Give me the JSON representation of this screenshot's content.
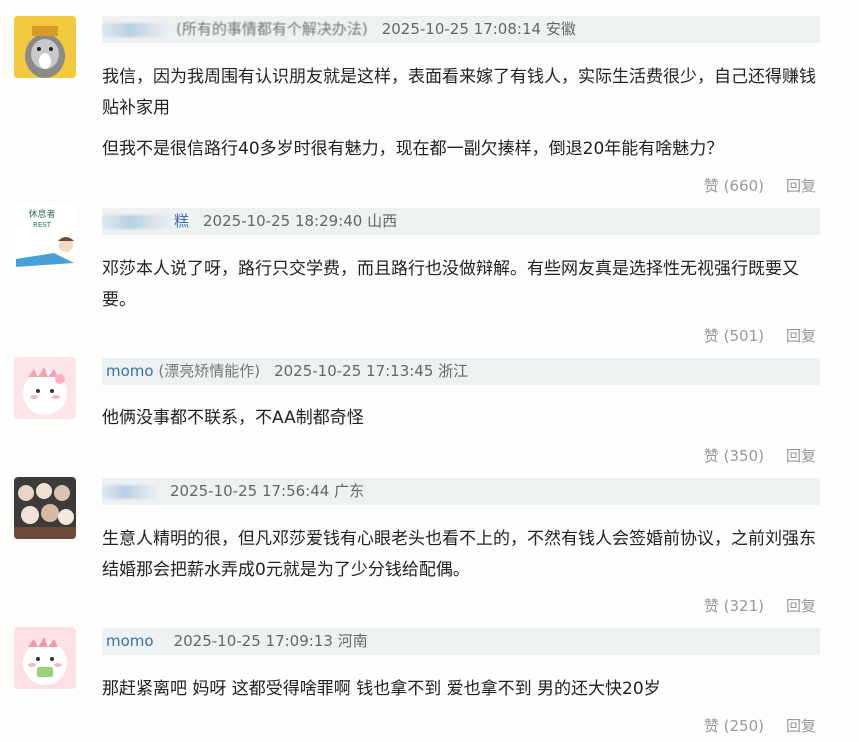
{
  "comments": [
    {
      "user": "",
      "tag": "(所有的事情都有个解决办法)",
      "time": "2025-10-25 17:08:14",
      "location": "安徽",
      "paragraphs": [
        "我信，因为我周围有认识朋友就是这样，表面看来嫁了有钱人，实际生活费很少，自己还得赚钱贴补家用",
        "但我不是很信路行40多岁时很有魅力，现在都一副欠揍样，倒退20年能有啥魅力？"
      ],
      "like": "赞 (660)",
      "reply": "回复"
    },
    {
      "user": "糕",
      "tag": "",
      "time": "2025-10-25 18:29:40",
      "location": "山西",
      "paragraphs": [
        "邓莎本人说了呀，路行只交学费，而且路行也没做辩解。有些网友真是选择性无视强行既要又要。"
      ],
      "like": "赞 (501)",
      "reply": "回复",
      "avatar_text": "休息者",
      "avatar_text2": "REST"
    },
    {
      "user": "momo",
      "tag": "(漂亮矫情能作)",
      "time": "2025-10-25 17:13:45",
      "location": "浙江",
      "paragraphs": [
        "他俩没事都不联系，不AA制都奇怪"
      ],
      "like": "赞 (350)",
      "reply": "回复"
    },
    {
      "user": "",
      "tag": "",
      "time": "2025-10-25 17:56:44",
      "location": "广东",
      "paragraphs": [
        "生意人精明的很，但凡邓莎爱钱有心眼老头也看不上的，不然有钱人会签婚前协议，之前刘强东结婚那会把薪水弄成0元就是为了少分钱给配偶。"
      ],
      "like": "赞 (321)",
      "reply": "回复"
    },
    {
      "user": "momo",
      "tag": "",
      "time": "2025-10-25 17:09:13",
      "location": "河南",
      "paragraphs": [
        "那赶紧离吧 妈呀 这都受得啥罪啊 钱也拿不到 爱也拿不到 男的还大快20岁"
      ],
      "like": "赞 (250)",
      "reply": "回复"
    }
  ],
  "colors": {
    "username": "#3a70a8",
    "header_bg": "#eef1f1",
    "action_text": "#999999"
  },
  "icons": [
    "bear-avatar-icon",
    "sleeping-avatar-icon",
    "pink-dino-avatar-icon",
    "group-photo-avatar-icon",
    "pink-dino-avatar-icon"
  ]
}
